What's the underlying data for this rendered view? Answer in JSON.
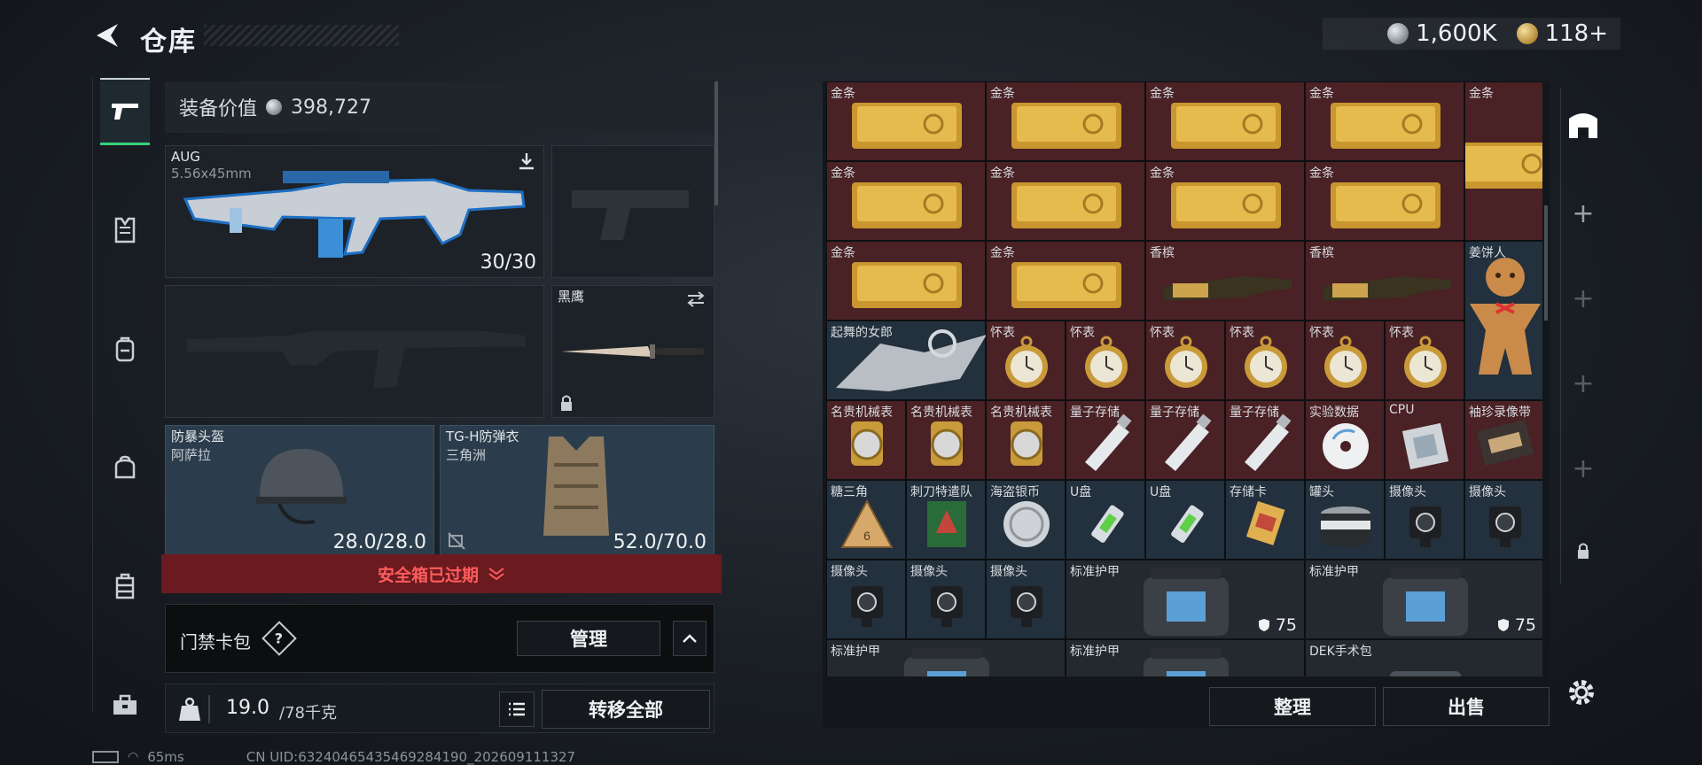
{
  "header": {
    "title": "仓库",
    "currency_silver": "1,600K",
    "currency_gold": "118+"
  },
  "nav": {
    "items": [
      "gun-icon",
      "armor-vest-icon",
      "backpack-icon",
      "bag-icon",
      "chest-rig-icon",
      "toolbox-icon"
    ],
    "active": 0
  },
  "loadout": {
    "equip_value_label": "装备价值",
    "equip_value": "398,727",
    "primary": {
      "name": "AUG",
      "caliber": "5.56x45mm",
      "ammo": "30/30"
    },
    "melee": {
      "name": "黑鹰"
    },
    "helmet": {
      "name": "防暴头盔",
      "sub": "阿萨拉",
      "durability": "28.0/28.0"
    },
    "armor": {
      "name": "TG-H防弹衣",
      "sub": "三角洲",
      "durability": "52.0/70.0"
    },
    "safe_status": "安全箱已过期",
    "card_pack_label": "门禁卡包",
    "manage_label": "管理",
    "weight_value": "19.0",
    "weight_max": "/78千克",
    "transfer_all_label": "转移全部"
  },
  "storage": {
    "sort_label": "整理",
    "sell_label": "出售",
    "items": [
      {
        "name": "金条",
        "color": "red",
        "icon": "gold-bar"
      },
      {
        "name": "金条",
        "color": "red",
        "icon": "gold-bar"
      },
      {
        "name": "金条",
        "color": "red",
        "icon": "gold-bar"
      },
      {
        "name": "金条",
        "color": "red",
        "icon": "gold-bar"
      },
      {
        "name": "金条",
        "color": "red",
        "icon": "gold-bar"
      },
      {
        "name": "金条",
        "color": "red",
        "icon": "gold-bar"
      },
      {
        "name": "金条",
        "color": "red",
        "icon": "gold-bar"
      },
      {
        "name": "金条",
        "color": "red",
        "icon": "gold-bar"
      },
      {
        "name": "金条",
        "color": "red",
        "icon": "gold-bar"
      },
      {
        "name": "金条",
        "color": "red",
        "icon": "gold-bar"
      },
      {
        "name": "金条",
        "color": "red",
        "icon": "gold-bar"
      },
      {
        "name": "香槟",
        "color": "red",
        "icon": "champagne"
      },
      {
        "name": "香槟",
        "color": "red",
        "icon": "champagne"
      },
      {
        "name": "姜饼人",
        "color": "blue",
        "icon": "gingerbread"
      },
      {
        "name": "起舞的女郎",
        "color": "blue",
        "icon": "dancer-statue"
      },
      {
        "name": "怀表",
        "color": "red",
        "icon": "pocket-watch"
      },
      {
        "name": "怀表",
        "color": "red",
        "icon": "pocket-watch"
      },
      {
        "name": "怀表",
        "color": "red",
        "icon": "pocket-watch"
      },
      {
        "name": "怀表",
        "color": "red",
        "icon": "pocket-watch"
      },
      {
        "name": "怀表",
        "color": "red",
        "icon": "pocket-watch"
      },
      {
        "name": "怀表",
        "color": "red",
        "icon": "pocket-watch"
      },
      {
        "name": "名贵机械表",
        "color": "red",
        "icon": "wrist-watch"
      },
      {
        "name": "名贵机械表",
        "color": "red",
        "icon": "wrist-watch"
      },
      {
        "name": "名贵机械表",
        "color": "red",
        "icon": "wrist-watch"
      },
      {
        "name": "量子存储",
        "color": "red",
        "icon": "quantum-drive"
      },
      {
        "name": "量子存储",
        "color": "red",
        "icon": "quantum-drive"
      },
      {
        "name": "量子存储",
        "color": "red",
        "icon": "quantum-drive"
      },
      {
        "name": "实验数据",
        "color": "red",
        "icon": "disc"
      },
      {
        "name": "CPU",
        "color": "red",
        "icon": "cpu"
      },
      {
        "name": "袖珍录像带",
        "color": "red",
        "icon": "tape"
      },
      {
        "name": "糖三角",
        "color": "blue",
        "icon": "sugar-triangle"
      },
      {
        "name": "刺刀特遣队",
        "color": "blue",
        "icon": "bayonet-card"
      },
      {
        "name": "海盗银币",
        "color": "blue",
        "icon": "silver-coin"
      },
      {
        "name": "U盘",
        "color": "blue",
        "icon": "usb"
      },
      {
        "name": "U盘",
        "color": "blue",
        "icon": "usb"
      },
      {
        "name": "存储卡",
        "color": "blue",
        "icon": "memory-card"
      },
      {
        "name": "罐头",
        "color": "blue",
        "icon": "can"
      },
      {
        "name": "摄像头",
        "color": "blue",
        "icon": "camera"
      },
      {
        "name": "摄像头",
        "color": "blue",
        "icon": "camera"
      },
      {
        "name": "摄像头",
        "color": "blue",
        "icon": "camera"
      },
      {
        "name": "摄像头",
        "color": "blue",
        "icon": "camera"
      },
      {
        "name": "摄像头",
        "color": "blue",
        "icon": "camera"
      },
      {
        "name": "标准护甲",
        "color": "dark",
        "icon": "armor-kit",
        "durability": "75"
      },
      {
        "name": "标准护甲",
        "color": "dark",
        "icon": "armor-kit",
        "durability": "75"
      },
      {
        "name": "标准护甲",
        "color": "dark",
        "icon": "armor-kit"
      },
      {
        "name": "标准护甲",
        "color": "dark",
        "icon": "armor-kit"
      },
      {
        "name": "DEK手术包",
        "color": "dark",
        "icon": "surgery-kit"
      }
    ]
  },
  "status": {
    "ping": "65ms",
    "uid": "CN UID:63240465435469284190_202609111327"
  },
  "colors": {
    "red_cell": "#4a2124",
    "blue_cell": "#23303d",
    "safe_bar": "#6b1a1f",
    "accent_green": "#37d27b"
  }
}
